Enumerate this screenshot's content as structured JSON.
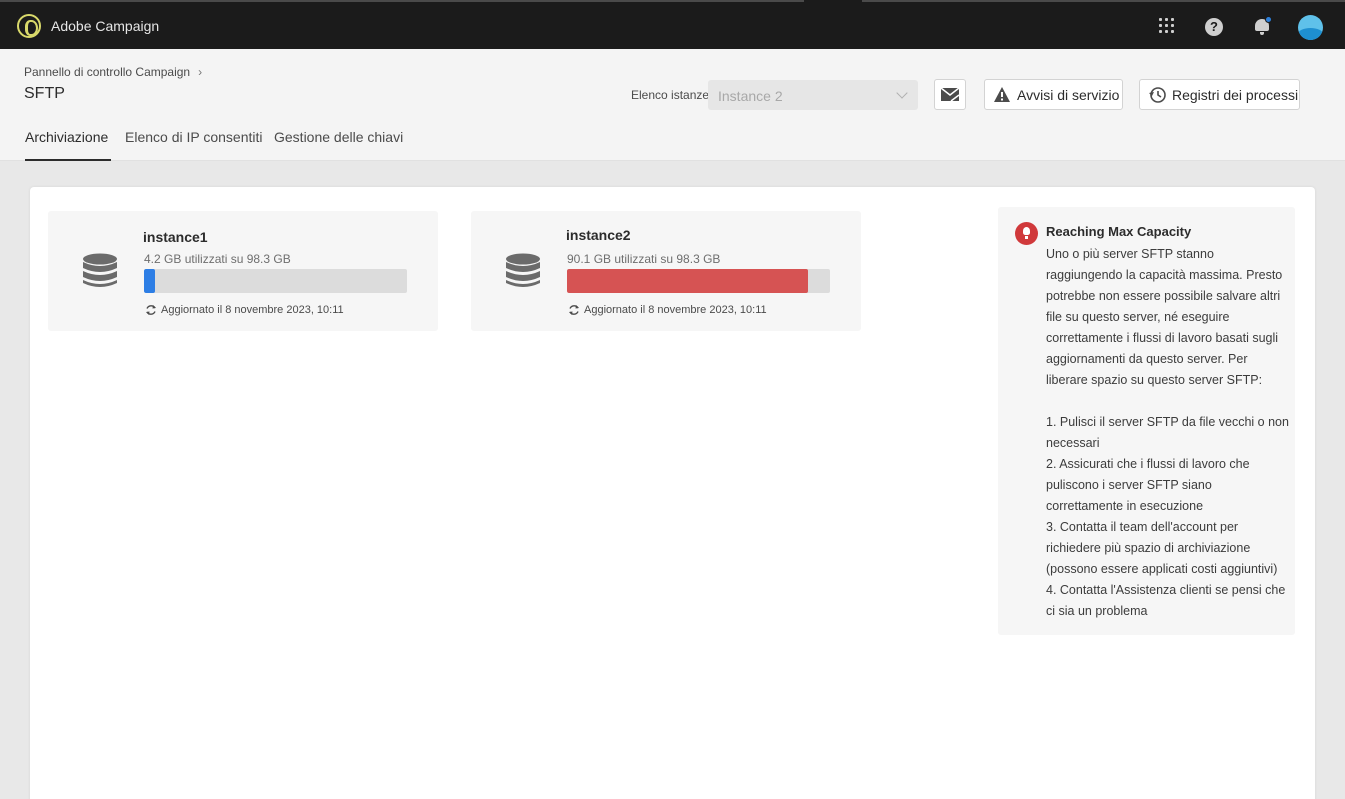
{
  "app": {
    "title": "Adobe Campaign"
  },
  "header": {
    "breadcrumb": "Pannello di controllo Campaign",
    "page_title": "SFTP",
    "instance_label": "Elenco istanze",
    "instance_placeholder": "Instance 2",
    "alerts_button": "Avvisi di servizio",
    "logs_button": "Registri dei processi"
  },
  "tabs": [
    {
      "label": "Archiviazione",
      "active": true
    },
    {
      "label": "Elenco di IP consentiti",
      "active": false
    },
    {
      "label": "Gestione delle chiavi",
      "active": false
    }
  ],
  "instances": [
    {
      "name": "instance1",
      "usage": "4.2 GB utilizzati su 98.3 GB",
      "used_gb": 4.2,
      "total_gb": 98.3,
      "updated": "Aggiornato il 8 novembre 2023, 10:11",
      "bar_color": "#2d7ee5"
    },
    {
      "name": "instance2",
      "usage": "90.1 GB utilizzati su  98.3 GB",
      "used_gb": 90.1,
      "total_gb": 98.3,
      "updated": "Aggiornato il 8 novembre 2023, 10:11",
      "bar_color": "#d65353"
    }
  ],
  "alert": {
    "title": "Reaching Max Capacity",
    "intro": "Uno o più server SFTP stanno raggiungendo la capacità massima. Presto potrebbe non essere possibile salvare altri file su questo server, né eseguire correttamente i flussi di lavoro basati sugli aggiornamenti da questo server. Per liberare spazio su questo server SFTP:",
    "steps": [
      "1. Pulisci il server SFTP da file vecchi o non necessari",
      "2. Assicurati che i flussi di lavoro che puliscono i server SFTP siano correttamente in esecuzione",
      "3. Contatta il team dell'account per richiedere più spazio di archiviazione (possono essere applicati costi aggiuntivi)",
      "4. Contatta l'Assistenza clienti se pensi che ci sia un problema"
    ],
    "color": "#d0393b"
  },
  "icons": {
    "logo": "adobe-campaign-logo",
    "apps": "grid-icon",
    "help": "help-icon",
    "notifications": "bell-icon",
    "avatar": "avatar",
    "mail": "mail-icon",
    "warning": "warning-icon",
    "history": "history-icon",
    "database": "database-icon",
    "refresh": "refresh-icon",
    "alert": "lightbulb-icon"
  }
}
